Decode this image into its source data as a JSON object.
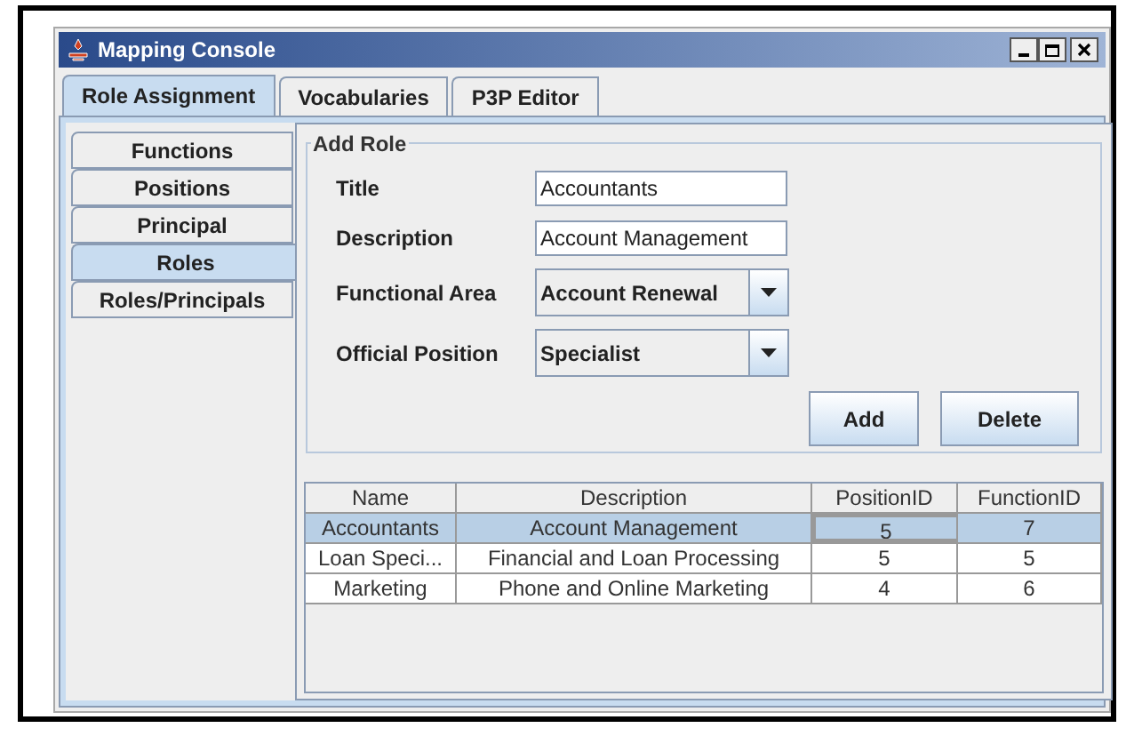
{
  "window": {
    "title": "Mapping Console"
  },
  "tabs": [
    {
      "label": "Role Assignment",
      "selected": true
    },
    {
      "label": "Vocabularies",
      "selected": false
    },
    {
      "label": "P3P Editor",
      "selected": false
    }
  ],
  "side_tabs": [
    {
      "label": "Functions",
      "selected": false
    },
    {
      "label": "Positions",
      "selected": false
    },
    {
      "label": "Principal",
      "selected": false
    },
    {
      "label": "Roles",
      "selected": true
    },
    {
      "label": "Roles/Principals",
      "selected": false
    }
  ],
  "add_role": {
    "title": "Add Role",
    "fields": [
      {
        "kind": "text",
        "label": "Title",
        "value": "Accountants"
      },
      {
        "kind": "text",
        "label": "Description",
        "value": "Account Management"
      },
      {
        "kind": "combo",
        "label": "Functional Area",
        "value": "Account Renewal"
      },
      {
        "kind": "combo",
        "label": "Official Position",
        "value": "Specialist"
      }
    ],
    "buttons": [
      "Add",
      "Delete"
    ]
  },
  "table": {
    "columns": [
      "Name",
      "Description",
      "PositionID",
      "FunctionID"
    ],
    "rows": [
      {
        "cells": [
          "Accountants",
          "Account Management",
          "5",
          "7"
        ],
        "selected": true
      },
      {
        "cells": [
          "Loan Speci...",
          "Financial and Loan Processing",
          "5",
          "5"
        ],
        "selected": false
      },
      {
        "cells": [
          "Marketing",
          "Phone and Online Marketing",
          "4",
          "6"
        ],
        "selected": false
      }
    ]
  }
}
